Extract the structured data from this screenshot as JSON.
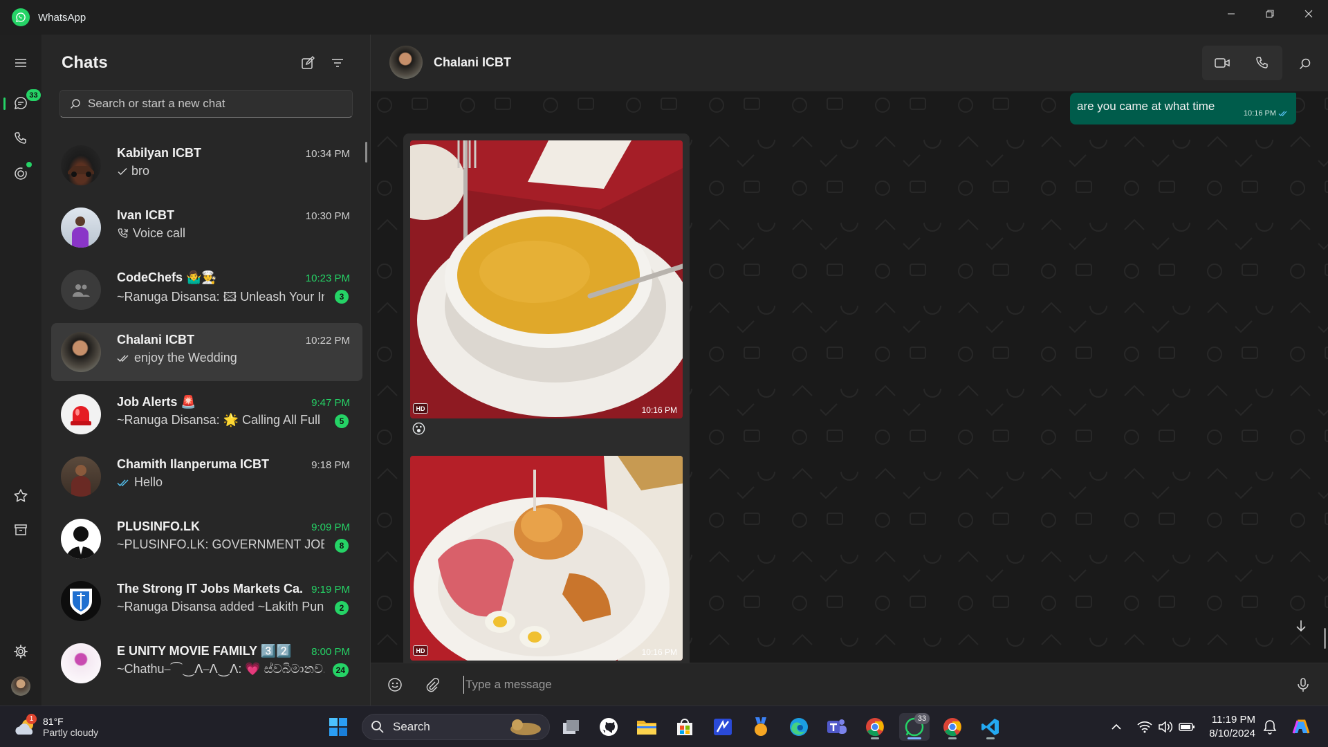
{
  "window": {
    "title": "WhatsApp"
  },
  "rail": {
    "chats_badge": "33"
  },
  "sidebar": {
    "title": "Chats",
    "search_placeholder": "Search or start a new chat",
    "chats": [
      {
        "name": "Kabilyan ICBT",
        "time": "10:34 PM",
        "preview": "bro",
        "status": "sent",
        "badge": "",
        "unread": false
      },
      {
        "name": "Ivan ICBT",
        "time": "10:30 PM",
        "preview": "Voice call",
        "status": "call",
        "badge": "",
        "unread": false
      },
      {
        "name": "CodeChefs 🤷‍♂️👨‍🍳",
        "time": "10:23 PM",
        "preview": "~Ranuga Disansa: 🖾 Unleash Your In...",
        "status": "",
        "badge": "3",
        "unread": true
      },
      {
        "name": "Chalani ICBT",
        "time": "10:22 PM",
        "preview": "enjoy the Wedding",
        "status": "delivered",
        "badge": "",
        "unread": false
      },
      {
        "name": "Job Alerts 🚨",
        "time": "9:47 PM",
        "preview": "~Ranuga Disansa: 🌟 Calling All Full S...",
        "status": "",
        "badge": "5",
        "unread": true
      },
      {
        "name": "Chamith Ilanperuma ICBT",
        "time": "9:18 PM",
        "preview": "Hello",
        "status": "read",
        "badge": "",
        "unread": false
      },
      {
        "name": "PLUSINFO.LK",
        "time": "9:09 PM",
        "preview": "~PLUSINFO.LK: GOVERNMENT JOB V...",
        "status": "",
        "badge": "8",
        "unread": true
      },
      {
        "name": "The Strong IT Jobs Markets Ca...",
        "time": "9:19 PM",
        "preview": "~Ranuga Disansa added ~Lakith Puns...",
        "status": "",
        "badge": "2",
        "unread": true
      },
      {
        "name": "E UNITY MOVIE FAMILY 3️⃣2️⃣",
        "time": "8:00 PM",
        "preview": "~Chathu⎯⏜⏝ᐱ⎯ᐱ⏝ᐱ: 💗 ස්වබිමානව...",
        "status": "",
        "badge": "24",
        "unread": true
      }
    ]
  },
  "conversation": {
    "contact_name": "Chalani ICBT",
    "outgoing_message": {
      "text": "are you came at what time",
      "time": "10:16 PM",
      "status": "read"
    },
    "media": [
      {
        "label": "HD",
        "time": "10:16 PM",
        "reaction": "😮"
      },
      {
        "label": "HD",
        "time": "10:16 PM"
      }
    ],
    "composer_placeholder": "Type a message"
  },
  "taskbar": {
    "weather_temp": "81°F",
    "weather_condition": "Partly cloudy",
    "weather_alert": "1",
    "search_label": "Search",
    "whatsapp_badge": "33",
    "time": "11:19 PM",
    "date": "8/10/2024"
  },
  "colors": {
    "accent": "#25d366",
    "bubble_out": "#005c4b",
    "selected_row": "#3a3a3a"
  }
}
